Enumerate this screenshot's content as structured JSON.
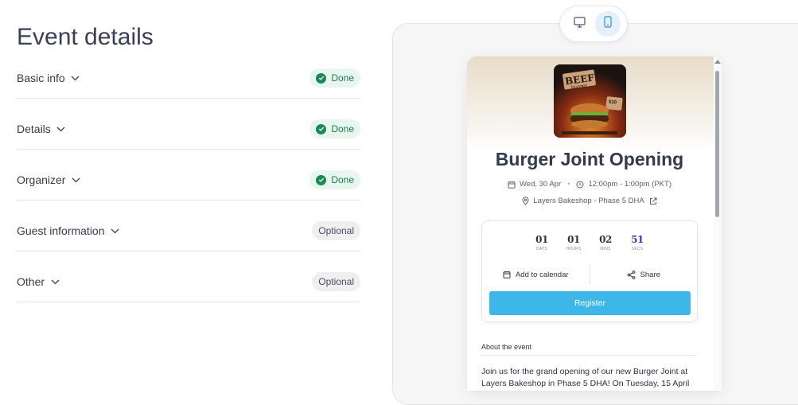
{
  "page_title": "Event details",
  "sections": [
    {
      "label": "Basic info",
      "status": "Done"
    },
    {
      "label": "Details",
      "status": "Done"
    },
    {
      "label": "Organizer",
      "status": "Done"
    },
    {
      "label": "Guest information",
      "status": "Optional"
    },
    {
      "label": "Other",
      "status": "Optional"
    }
  ],
  "preview": {
    "toggle": {
      "desktop_icon": "monitor-icon",
      "mobile_icon": "mobile-phone-icon",
      "active": "mobile"
    },
    "cover": {
      "line1": "BEEF",
      "line2": "burger",
      "price": "$10"
    },
    "event_title": "Burger Joint Opening",
    "date": "Wed, 30 Apr",
    "time": "12:00pm - 1:00pm (PKT)",
    "location": "Layers Bakeshop - Phase 5 DHA",
    "countdown": [
      {
        "value": "01",
        "unit": "DAYS"
      },
      {
        "value": "01",
        "unit": "HOURS"
      },
      {
        "value": "02",
        "unit": "MINS"
      },
      {
        "value": "51",
        "unit": "SECS"
      }
    ],
    "add_to_calendar": "Add to calendar",
    "share": "Share",
    "register": "Register",
    "about_label": "About the event",
    "about_text": "Join us for the grand opening of our new Burger Joint at Layers Bakeshop in Phase 5 DHA! On Tuesday, 15 April"
  },
  "colors": {
    "done_bg": "#e7f7ef",
    "done_text": "#1e7a4e",
    "optional_bg": "#efeff1",
    "register_bg": "#3db6e8",
    "secs_accent": "#4a2db0"
  }
}
